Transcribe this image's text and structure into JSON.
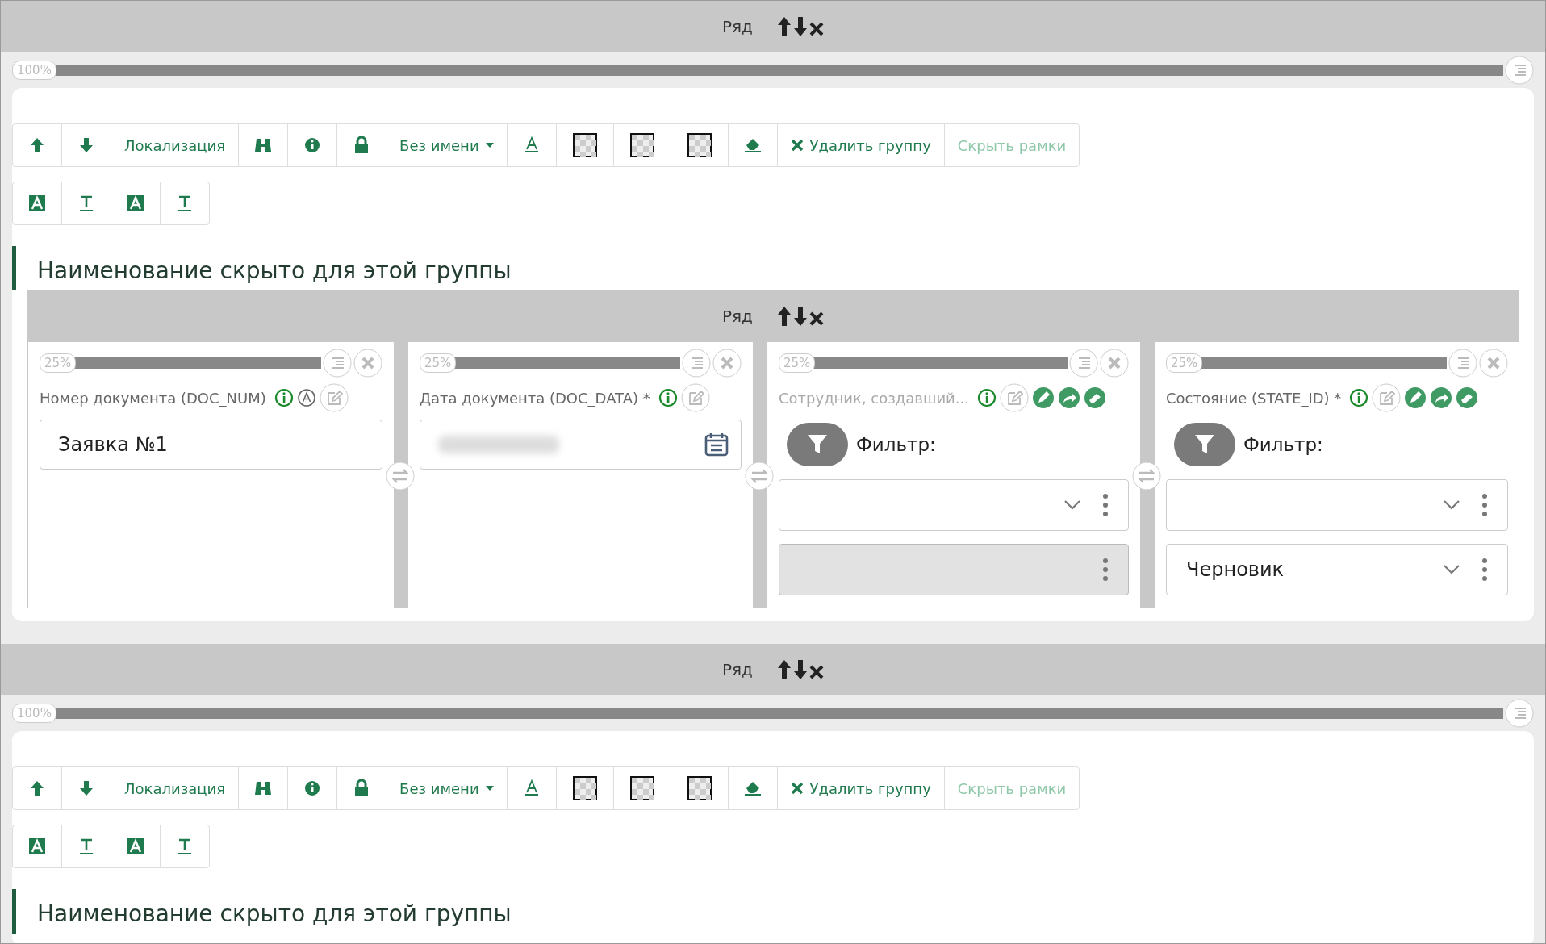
{
  "sections": [
    {
      "row_label": "Ряд",
      "width_label": "100%",
      "level": 1,
      "toolbar": [
        {
          "kind": "up"
        },
        {
          "kind": "down"
        },
        {
          "kind": "text",
          "label": "Локализация"
        },
        {
          "kind": "binoculars"
        },
        {
          "kind": "info"
        },
        {
          "kind": "lock"
        },
        {
          "kind": "dropdown",
          "label": "Без имени"
        },
        {
          "kind": "font"
        },
        {
          "kind": "checker"
        },
        {
          "kind": "checker"
        },
        {
          "kind": "checker"
        },
        {
          "kind": "eraser"
        },
        {
          "kind": "delete",
          "label": "Удалить группу"
        },
        {
          "kind": "muted",
          "label": "Скрыть рамки"
        }
      ],
      "format_toolbar": [
        {
          "kind": "fill"
        },
        {
          "kind": "underline"
        },
        {
          "kind": "fill"
        },
        {
          "kind": "underline"
        }
      ],
      "group_title": "Наименование скрыто для этой группы",
      "inner_row": {
        "row_label": "Ряд",
        "fields": [
          {
            "width_label": "25%",
            "level": 1,
            "label": "Номер документа (DOC_NUM)",
            "muted": false,
            "kind": "text",
            "value": "Заявка №1"
          },
          {
            "width_label": "25%",
            "level": 1,
            "label": "Дата документа (DOC_DATA) *",
            "muted": false,
            "kind": "date"
          },
          {
            "width_label": "25%",
            "level": 1,
            "label": "Сотрудник, создавший...",
            "muted": true,
            "kind": "lookup",
            "filter_label": "Фильтр:",
            "selects": [
              {
                "disabled": false
              },
              {
                "disabled": true
              }
            ]
          },
          {
            "width_label": "25%",
            "level": 1,
            "label": "Состояние (STATE_ID) *",
            "muted": false,
            "kind": "lookup",
            "filter_label": "Фильтр:",
            "selects": [
              {
                "disabled": false
              },
              {
                "disabled": false,
                "value": "Черновик"
              }
            ]
          }
        ]
      }
    },
    {
      "row_label": "Ряд",
      "width_label": "100%",
      "level": 1,
      "toolbar": [
        {
          "kind": "up"
        },
        {
          "kind": "down"
        },
        {
          "kind": "text",
          "label": "Локализация"
        },
        {
          "kind": "binoculars"
        },
        {
          "kind": "info"
        },
        {
          "kind": "lock"
        },
        {
          "kind": "dropdown",
          "label": "Без имени"
        },
        {
          "kind": "font"
        },
        {
          "kind": "checker"
        },
        {
          "kind": "checker"
        },
        {
          "kind": "checker"
        },
        {
          "kind": "eraser"
        },
        {
          "kind": "delete",
          "label": "Удалить группу"
        },
        {
          "kind": "muted",
          "label": "Скрыть рамки"
        }
      ],
      "format_toolbar": [
        {
          "kind": "fill"
        },
        {
          "kind": "underline"
        },
        {
          "kind": "fill"
        },
        {
          "kind": "underline"
        }
      ],
      "group_title": "Наименование скрыто для этой группы"
    }
  ]
}
